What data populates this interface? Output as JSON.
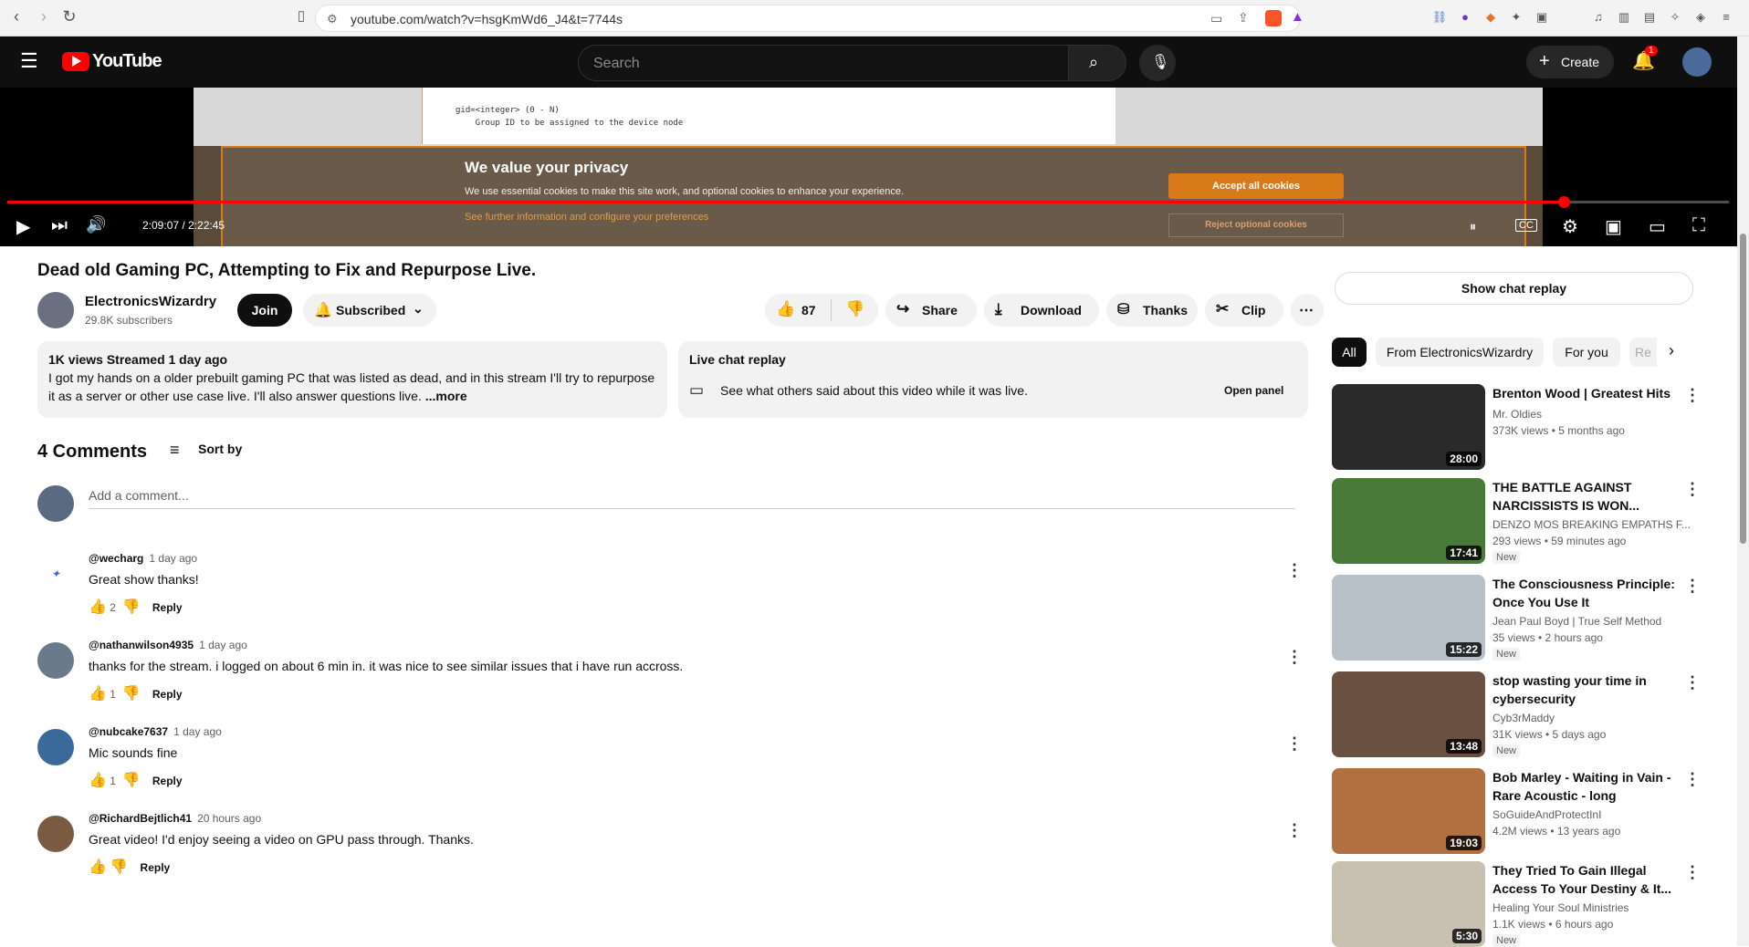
{
  "browser": {
    "url": "youtube.com/watch?v=hsgKmWd6_J4&t=7744s"
  },
  "topbar": {
    "logo_text": "YouTube",
    "search_placeholder": "Search",
    "create_label": "Create",
    "notification_count": "1"
  },
  "player": {
    "doc_text": "gid=<integer> (0 - N)\n    Group ID to be assigned to the device node",
    "cookie_title": "We value your privacy",
    "cookie_text": "We use essential cookies to make this site work, and optional cookies to enhance your experience.",
    "cookie_more": "See further information and configure your preferences",
    "accept_label": "Accept all cookies",
    "reject_label": "Reject optional cookies",
    "timecode": "2:09:07 / 2:22:45",
    "progress": 0.904
  },
  "video": {
    "title": "Dead old Gaming PC, Attempting to Fix and Repurpose Live.",
    "channel": "ElectronicsWizardry",
    "subscribers": "29.8K subscribers",
    "join_label": "Join",
    "subscribed_label": "Subscribed",
    "likes": "87",
    "share_label": "Share",
    "download_label": "Download",
    "thanks_label": "Thanks",
    "clip_label": "Clip"
  },
  "description": {
    "meta": "1K views  Streamed 1 day ago",
    "line1": "I got my hands on a older prebuilt gaming PC that was listed as dead, and in this stream I'll try to repurpose",
    "line2": "it as a server or other use case live. I'll also answer questions live.",
    "more": "...more"
  },
  "live_chat": {
    "title": "Live chat replay",
    "text": "See what others said about this video while it was live.",
    "open_panel": "Open panel"
  },
  "comments": {
    "count_label": "4 Comments",
    "sort_label": "Sort by",
    "add_placeholder": "Add a comment...",
    "items": [
      {
        "author": "@wecharg",
        "when": "1 day ago",
        "text": "Great show thanks!",
        "likes": "2",
        "reply": "Reply"
      },
      {
        "author": "@nathanwilson4935",
        "when": "1 day ago",
        "text": "thanks for the stream. i logged on about 6 min in.  it was nice to see similar issues that i have run accross.",
        "likes": "1",
        "reply": "Reply"
      },
      {
        "author": "@nubcake7637",
        "when": "1 day ago",
        "text": "Mic sounds fine",
        "likes": "1",
        "reply": "Reply"
      },
      {
        "author": "@RichardBejtlich41",
        "when": "20 hours ago",
        "text": "Great video! I'd enjoy seeing a video on GPU pass through. Thanks.",
        "likes": "",
        "reply": "Reply"
      }
    ]
  },
  "sidebar": {
    "chat_replay_label": "Show chat replay",
    "chips": [
      "All",
      "From ElectronicsWizardry",
      "For you",
      "Re"
    ],
    "videos": [
      {
        "title": "Brenton Wood | Greatest Hits",
        "channel": "Mr. Oldies",
        "meta": "373K views  • 5 months ago",
        "duration": "28:00",
        "new": "",
        "thumb_color": "#2a2a2a"
      },
      {
        "title": "THE BATTLE AGAINST NARCISSISTS IS WON...",
        "channel": "DENZO MOS BREAKING EMPATHS F...",
        "meta": "293 views  • 59 minutes ago",
        "duration": "17:41",
        "new": "New",
        "thumb_color": "#4a7a3a"
      },
      {
        "title": "The Consciousness Principle: Once You Use It CORRECTLY...",
        "channel": "Jean Paul Boyd | True Self Method",
        "meta": "35 views  • 2 hours ago",
        "duration": "15:22",
        "new": "New",
        "thumb_color": "#b8c0c8"
      },
      {
        "title": "stop wasting your time in cybersecurity",
        "channel": "Cyb3rMaddy",
        "meta": "31K views  • 5 days ago",
        "duration": "13:48",
        "new": "New",
        "thumb_color": "#6a5040"
      },
      {
        "title": "Bob Marley - Waiting in Vain - Rare Acoustic - long",
        "channel": "SoGuideAndProtectInI",
        "meta": "4.2M views  • 13 years ago",
        "duration": "19:03",
        "new": "",
        "thumb_color": "#b07040"
      },
      {
        "title": "They Tried To Gain Illegal Access To Your Destiny & It...",
        "channel": "Healing Your Soul Ministries",
        "meta": "1.1K views  • 6 hours ago",
        "duration": "5:30",
        "new": "New",
        "thumb_color": "#c8c0b0"
      }
    ]
  },
  "colors": {
    "brand_red": "#ff0000",
    "dark": "#0f0f0f",
    "chip_bg": "#f2f2f2"
  }
}
